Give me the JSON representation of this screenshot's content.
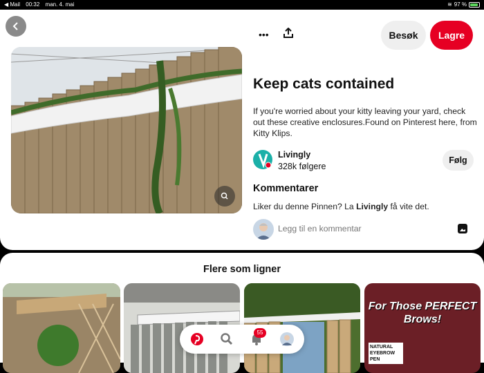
{
  "status_bar": {
    "app": "◀ Mail",
    "time": "00:32",
    "date": "man. 4. mai",
    "battery": "97 %"
  },
  "header": {
    "visit_label": "Besøk",
    "save_label": "Lagre"
  },
  "pin": {
    "title": "Keep cats contained",
    "description": "If you're worried about your kitty leaving your yard, check out these creative enclosures.Found on Pinterest here, from Kitty Klips.",
    "author": {
      "name": "Livingly",
      "followers": "328k følgere",
      "follow_label": "Følg"
    }
  },
  "comments": {
    "heading": "Kommentarer",
    "prompt_before": "Liker du denne Pinnen? La ",
    "prompt_name": "Livingly",
    "prompt_after": " få vite det.",
    "placeholder": "Legg til en kommentar"
  },
  "more": {
    "heading": "Flere som ligner",
    "promo_title": "For Those PERFECT Brows!",
    "promo_label": "NATURAL EYEBROW PEN"
  },
  "bottom_nav": {
    "notification_count": "55"
  },
  "colors": {
    "brand": "#e60023"
  }
}
